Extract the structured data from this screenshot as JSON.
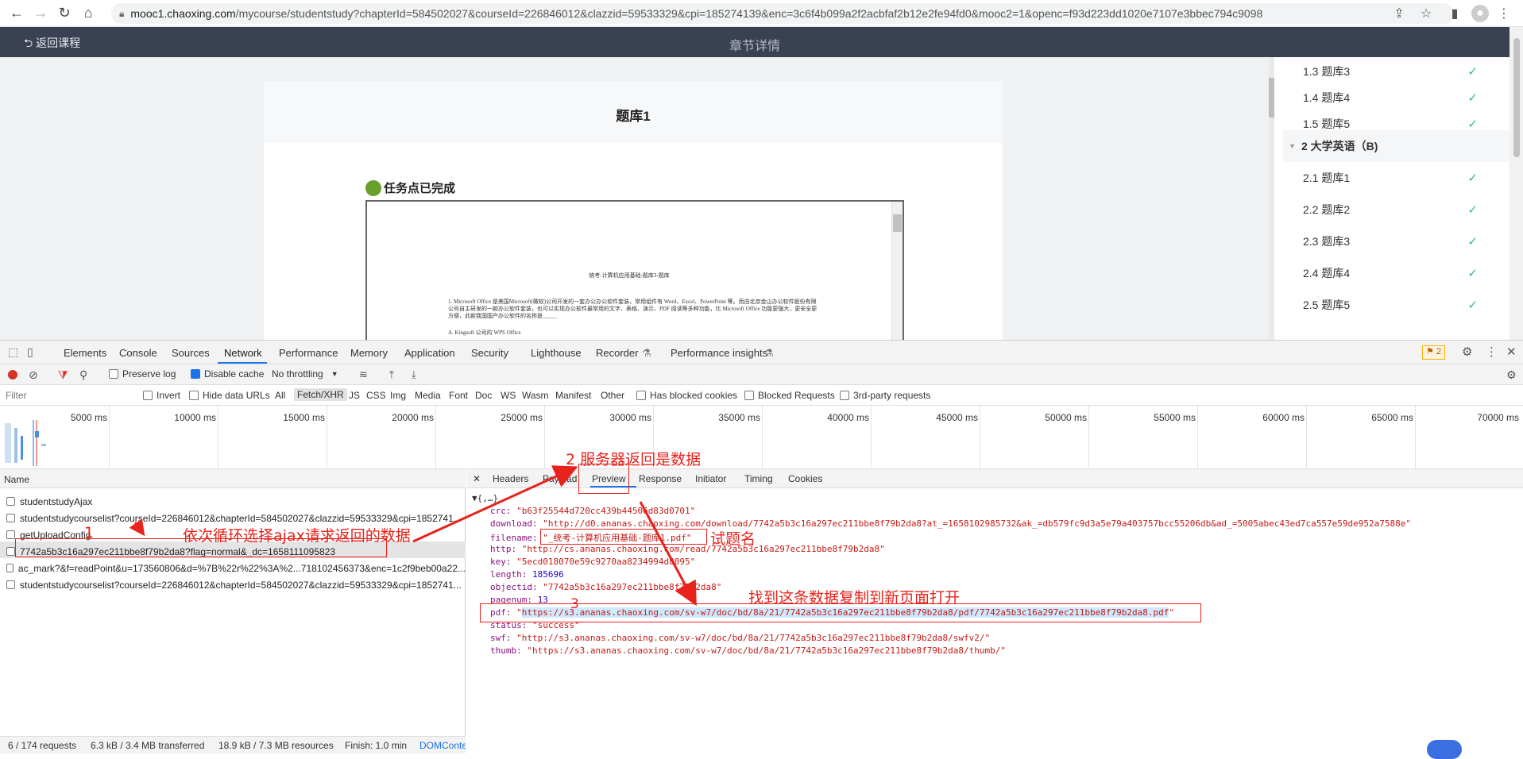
{
  "browser": {
    "url_host": "mooc1.chaoxing.com",
    "url_path": "/mycourse/studentstudy?chapterId=584502027&courseId=226846012&clazzid=59533329&cpi=185274139&enc=3c6f4b099a2f2acbfaf2b12e2fe94fd0&mooc2=1&openc=f93d223dd1020e7107e3bbec794c9098"
  },
  "course_header": {
    "back_label": "返回课程",
    "title": "章节详情"
  },
  "content": {
    "card_title": "题库1",
    "task_status": "任务点已完成",
    "pdf_doc_title": "统考-计算机应用基础-题库3-题库",
    "pdf_question": "1. Microsoft Office 是美国Microsoft(微软)公司开发的一套办公办公软件套装，常用组件有 Word、Excel、PowerPoint 等。而由北京金山办公软件股份有限公司自主研发的一款办公软件套装，也可以实现办公软件最常用的文字、表格、演示、PDF 阅读等多种功能，比 Microsoft Office 功能更强大，更安全更方便，此款我国国产办公软件的名称是_____",
    "pdf_option": "A. Kingsoft 公司的 WPS Office"
  },
  "sidebar": {
    "items": [
      {
        "label": "1.3 题库3",
        "check": "✓"
      },
      {
        "label": "1.4 题库4",
        "check": "✓"
      },
      {
        "label": "1.5 题库5",
        "check": "✓"
      },
      {
        "label": "2 大学英语（B)",
        "group": true
      },
      {
        "label": "2.1 题库1",
        "check": "✓"
      },
      {
        "label": "2.2 题库2",
        "check": "✓"
      },
      {
        "label": "2.3 题库3",
        "check": "✓"
      },
      {
        "label": "2.4 题库4",
        "check": "✓"
      },
      {
        "label": "2.5 题库5",
        "check": "✓"
      }
    ]
  },
  "devtools": {
    "tabs": [
      "Elements",
      "Console",
      "Sources",
      "Network",
      "Performance",
      "Memory",
      "Application",
      "Security",
      "Lighthouse",
      "Recorder",
      "Performance insights"
    ],
    "active_tab": "Network",
    "issues_count": "2",
    "toolbar": {
      "preserve_log": "Preserve log",
      "disable_cache": "Disable cache",
      "throttling": "No throttling"
    },
    "filter": {
      "placeholder": "Filter",
      "invert": "Invert",
      "hide_data_urls": "Hide data URLs",
      "types": [
        "All",
        "Fetch/XHR",
        "JS",
        "CSS",
        "Img",
        "Media",
        "Font",
        "Doc",
        "WS",
        "Wasm",
        "Manifest",
        "Other"
      ],
      "selected_type": "Fetch/XHR",
      "has_blocked": "Has blocked cookies",
      "blocked_requests": "Blocked Requests",
      "third_party": "3rd-party requests"
    },
    "timeline_ticks": [
      "5000 ms",
      "10000 ms",
      "15000 ms",
      "20000 ms",
      "25000 ms",
      "30000 ms",
      "35000 ms",
      "40000 ms",
      "45000 ms",
      "50000 ms",
      "55000 ms",
      "60000 ms",
      "65000 ms",
      "70000 ms"
    ],
    "requests": {
      "header": "Name",
      "rows": [
        "studentstudyAjax",
        "studentstudycourselist?courseId=226846012&chapterId=584502027&clazzid=59533329&cpi=1852741...",
        "getUploadConfig",
        "7742a5b3c16a297ec211bbe8f79b2da8?flag=normal&_dc=1658111095823",
        "ac_mark?&f=readPoint&u=173560806&d=%7B%22r%22%3A%2...718102456373&enc=1c2f9beb00a22...",
        "studentstudycourselist?courseId=226846012&chapterId=584502027&clazzid=59533329&cpi=1852741..."
      ],
      "selected_index": 3,
      "footer": [
        "6 / 174 requests",
        "6.3 kB / 3.4 MB transferred",
        "18.9 kB / 7.3 MB resources",
        "Finish: 1.0 min",
        "DOMConte"
      ]
    },
    "detail_tabs": [
      "Headers",
      "Payload",
      "Preview",
      "Response",
      "Initiator",
      "Timing",
      "Cookies"
    ],
    "detail_active": "Preview",
    "json": {
      "root": "▼{,…}",
      "crc_key": "crc:",
      "crc_val": "\"b63f25544d720cc439b44506d83d0701\"",
      "download_key": "download:",
      "download_val": "\"http://d0.ananas.chaoxing.com/download/7742a5b3c16a297ec211bbe8f79b2da8?at_=1658102985732&ak_=db579fc9d3a5e79a403757bcc55206db&ad_=5005abec43ed7ca557e59de952a7588e\"",
      "filename_key": "filename:",
      "filename_val": "\"_统考-计算机应用基础-题库1.pdf\"",
      "http_key": "http:",
      "http_val": "\"http://cs.ananas.chaoxing.com/read/7742a5b3c16a297ec211bbe8f79b2da8\"",
      "key_key": "key:",
      "key_val": "\"5ecd018070e59c9270aa8234994d8095\"",
      "length_key": "length:",
      "length_val": "185696",
      "objectid_key": "objectid:",
      "objectid_val": "\"7742a5b3c16a297ec211bbe8f79b2da8\"",
      "pagenum_key": "pagenum:",
      "pagenum_val": "13",
      "pdf_key": "pdf:",
      "pdf_val": "https://s3.ananas.chaoxing.com/sv-w7/doc/bd/8a/21/7742a5b3c16a297ec211bbe8f79b2da8/pdf/7742a5b3c16a297ec211bbe8f79b2da8.pdf",
      "status_key": "status:",
      "status_val": "\"success\"",
      "swf_key": "swf:",
      "swf_val": "\"http://s3.ananas.chaoxing.com/sv-w7/doc/bd/8a/21/7742a5b3c16a297ec211bbe8f79b2da8/swfv2/\"",
      "thumb_key": "thumb:",
      "thumb_val": "\"https://s3.ananas.chaoxing.com/sv-w7/doc/bd/8a/21/7742a5b3c16a297ec211bbe8f79b2da8/thumb/\""
    }
  },
  "annotations": {
    "step1": "依次循环选择ajax请求返回的数据",
    "step1_num": "1",
    "step2": "2  服务器返回是数据",
    "step3_num": "3",
    "step3": "找到这条数据复制到新页面打开",
    "filename_note": "试题名"
  },
  "colors": {
    "accent": "#1a73e8",
    "annotation": "#e8221c",
    "header_bg": "#3a4152",
    "check": "#2fbf72"
  }
}
